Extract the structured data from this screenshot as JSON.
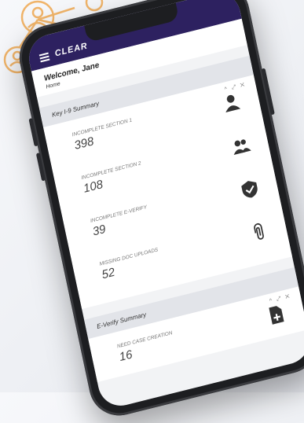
{
  "app": {
    "brand": "CLEAR"
  },
  "welcome": {
    "greeting": "Welcome, Jane",
    "breadcrumb": "Home"
  },
  "i9": {
    "title": "Key I-9 Summary",
    "controls": "^ ⤢ ✕",
    "metrics": [
      {
        "label": "INCOMPLETE SECTION 1",
        "value": "398",
        "icon": "person-icon"
      },
      {
        "label": "INCOMPLETE SECTION 2",
        "value": "108",
        "icon": "group-icon"
      },
      {
        "label": "INCOMPLETE E-VERIFY",
        "value": "39",
        "icon": "shield-check-icon"
      },
      {
        "label": "MISSING DOC UPLOADS",
        "value": "52",
        "icon": "paperclip-icon"
      }
    ]
  },
  "everify": {
    "title": "E-Verify Summary",
    "controls": "^ ⤢ ✕",
    "metrics": [
      {
        "label": "NEED CASE CREATION",
        "value": "16",
        "icon": "add-document-icon"
      }
    ]
  },
  "colors": {
    "header": "#2d2160",
    "decor": "#f0b46a",
    "icon": "#333333"
  }
}
